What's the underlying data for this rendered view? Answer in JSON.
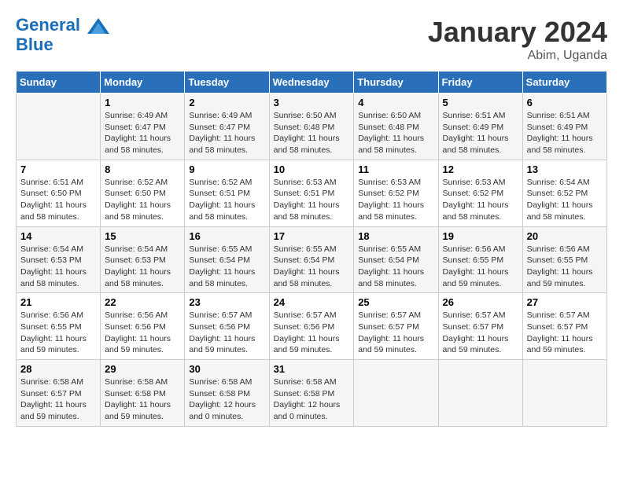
{
  "header": {
    "logo_line1": "General",
    "logo_line2": "Blue",
    "month": "January 2024",
    "location": "Abim, Uganda"
  },
  "columns": [
    "Sunday",
    "Monday",
    "Tuesday",
    "Wednesday",
    "Thursday",
    "Friday",
    "Saturday"
  ],
  "weeks": [
    [
      {
        "day": "",
        "sunrise": "",
        "sunset": "",
        "daylight": ""
      },
      {
        "day": "1",
        "sunrise": "Sunrise: 6:49 AM",
        "sunset": "Sunset: 6:47 PM",
        "daylight": "Daylight: 11 hours and 58 minutes."
      },
      {
        "day": "2",
        "sunrise": "Sunrise: 6:49 AM",
        "sunset": "Sunset: 6:47 PM",
        "daylight": "Daylight: 11 hours and 58 minutes."
      },
      {
        "day": "3",
        "sunrise": "Sunrise: 6:50 AM",
        "sunset": "Sunset: 6:48 PM",
        "daylight": "Daylight: 11 hours and 58 minutes."
      },
      {
        "day": "4",
        "sunrise": "Sunrise: 6:50 AM",
        "sunset": "Sunset: 6:48 PM",
        "daylight": "Daylight: 11 hours and 58 minutes."
      },
      {
        "day": "5",
        "sunrise": "Sunrise: 6:51 AM",
        "sunset": "Sunset: 6:49 PM",
        "daylight": "Daylight: 11 hours and 58 minutes."
      },
      {
        "day": "6",
        "sunrise": "Sunrise: 6:51 AM",
        "sunset": "Sunset: 6:49 PM",
        "daylight": "Daylight: 11 hours and 58 minutes."
      }
    ],
    [
      {
        "day": "7",
        "sunrise": "Sunrise: 6:51 AM",
        "sunset": "Sunset: 6:50 PM",
        "daylight": "Daylight: 11 hours and 58 minutes."
      },
      {
        "day": "8",
        "sunrise": "Sunrise: 6:52 AM",
        "sunset": "Sunset: 6:50 PM",
        "daylight": "Daylight: 11 hours and 58 minutes."
      },
      {
        "day": "9",
        "sunrise": "Sunrise: 6:52 AM",
        "sunset": "Sunset: 6:51 PM",
        "daylight": "Daylight: 11 hours and 58 minutes."
      },
      {
        "day": "10",
        "sunrise": "Sunrise: 6:53 AM",
        "sunset": "Sunset: 6:51 PM",
        "daylight": "Daylight: 11 hours and 58 minutes."
      },
      {
        "day": "11",
        "sunrise": "Sunrise: 6:53 AM",
        "sunset": "Sunset: 6:52 PM",
        "daylight": "Daylight: 11 hours and 58 minutes."
      },
      {
        "day": "12",
        "sunrise": "Sunrise: 6:53 AM",
        "sunset": "Sunset: 6:52 PM",
        "daylight": "Daylight: 11 hours and 58 minutes."
      },
      {
        "day": "13",
        "sunrise": "Sunrise: 6:54 AM",
        "sunset": "Sunset: 6:52 PM",
        "daylight": "Daylight: 11 hours and 58 minutes."
      }
    ],
    [
      {
        "day": "14",
        "sunrise": "Sunrise: 6:54 AM",
        "sunset": "Sunset: 6:53 PM",
        "daylight": "Daylight: 11 hours and 58 minutes."
      },
      {
        "day": "15",
        "sunrise": "Sunrise: 6:54 AM",
        "sunset": "Sunset: 6:53 PM",
        "daylight": "Daylight: 11 hours and 58 minutes."
      },
      {
        "day": "16",
        "sunrise": "Sunrise: 6:55 AM",
        "sunset": "Sunset: 6:54 PM",
        "daylight": "Daylight: 11 hours and 58 minutes."
      },
      {
        "day": "17",
        "sunrise": "Sunrise: 6:55 AM",
        "sunset": "Sunset: 6:54 PM",
        "daylight": "Daylight: 11 hours and 58 minutes."
      },
      {
        "day": "18",
        "sunrise": "Sunrise: 6:55 AM",
        "sunset": "Sunset: 6:54 PM",
        "daylight": "Daylight: 11 hours and 58 minutes."
      },
      {
        "day": "19",
        "sunrise": "Sunrise: 6:56 AM",
        "sunset": "Sunset: 6:55 PM",
        "daylight": "Daylight: 11 hours and 59 minutes."
      },
      {
        "day": "20",
        "sunrise": "Sunrise: 6:56 AM",
        "sunset": "Sunset: 6:55 PM",
        "daylight": "Daylight: 11 hours and 59 minutes."
      }
    ],
    [
      {
        "day": "21",
        "sunrise": "Sunrise: 6:56 AM",
        "sunset": "Sunset: 6:55 PM",
        "daylight": "Daylight: 11 hours and 59 minutes."
      },
      {
        "day": "22",
        "sunrise": "Sunrise: 6:56 AM",
        "sunset": "Sunset: 6:56 PM",
        "daylight": "Daylight: 11 hours and 59 minutes."
      },
      {
        "day": "23",
        "sunrise": "Sunrise: 6:57 AM",
        "sunset": "Sunset: 6:56 PM",
        "daylight": "Daylight: 11 hours and 59 minutes."
      },
      {
        "day": "24",
        "sunrise": "Sunrise: 6:57 AM",
        "sunset": "Sunset: 6:56 PM",
        "daylight": "Daylight: 11 hours and 59 minutes."
      },
      {
        "day": "25",
        "sunrise": "Sunrise: 6:57 AM",
        "sunset": "Sunset: 6:57 PM",
        "daylight": "Daylight: 11 hours and 59 minutes."
      },
      {
        "day": "26",
        "sunrise": "Sunrise: 6:57 AM",
        "sunset": "Sunset: 6:57 PM",
        "daylight": "Daylight: 11 hours and 59 minutes."
      },
      {
        "day": "27",
        "sunrise": "Sunrise: 6:57 AM",
        "sunset": "Sunset: 6:57 PM",
        "daylight": "Daylight: 11 hours and 59 minutes."
      }
    ],
    [
      {
        "day": "28",
        "sunrise": "Sunrise: 6:58 AM",
        "sunset": "Sunset: 6:57 PM",
        "daylight": "Daylight: 11 hours and 59 minutes."
      },
      {
        "day": "29",
        "sunrise": "Sunrise: 6:58 AM",
        "sunset": "Sunset: 6:58 PM",
        "daylight": "Daylight: 11 hours and 59 minutes."
      },
      {
        "day": "30",
        "sunrise": "Sunrise: 6:58 AM",
        "sunset": "Sunset: 6:58 PM",
        "daylight": "Daylight: 12 hours and 0 minutes."
      },
      {
        "day": "31",
        "sunrise": "Sunrise: 6:58 AM",
        "sunset": "Sunset: 6:58 PM",
        "daylight": "Daylight: 12 hours and 0 minutes."
      },
      {
        "day": "",
        "sunrise": "",
        "sunset": "",
        "daylight": ""
      },
      {
        "day": "",
        "sunrise": "",
        "sunset": "",
        "daylight": ""
      },
      {
        "day": "",
        "sunrise": "",
        "sunset": "",
        "daylight": ""
      }
    ]
  ]
}
